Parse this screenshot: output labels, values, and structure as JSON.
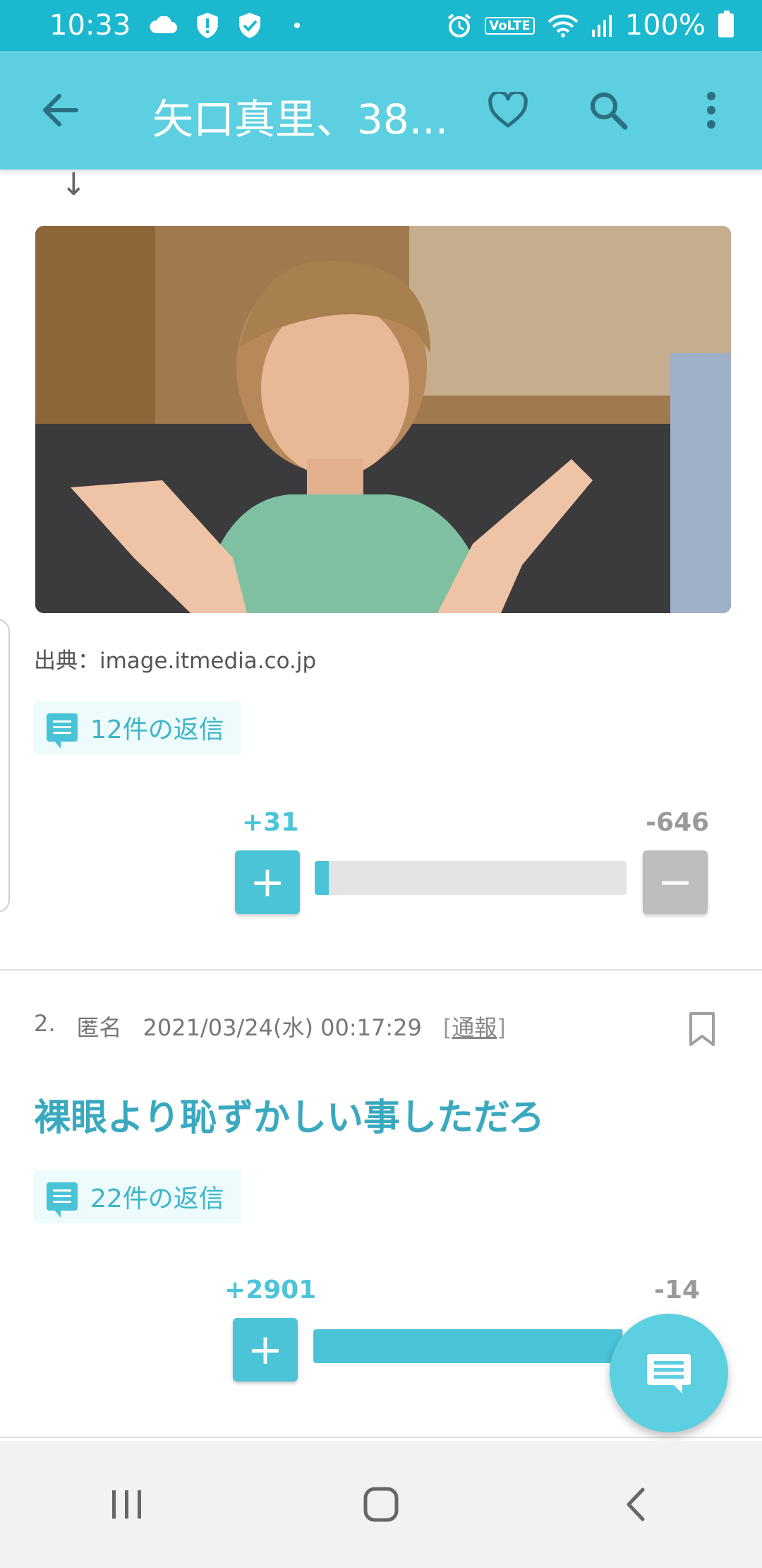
{
  "status_bar": {
    "time": "10:33",
    "battery": "100%",
    "network_badge": "VoLTE",
    "icons": [
      "cloud-icon",
      "shield-alert-icon",
      "shield-check-icon",
      "alarm-icon",
      "wifi-icon",
      "signal-icon",
      "battery-icon"
    ]
  },
  "app_bar": {
    "title": "矢口真里、38...",
    "icons": [
      "back-arrow-icon",
      "heart-icon",
      "search-icon",
      "more-vert-icon"
    ]
  },
  "post1": {
    "down_arrow": "↓",
    "image_alt": "photo",
    "source_label": "出典：image.itmedia.co.jp",
    "replies_label": "12件の返信",
    "plus_count": "+31",
    "minus_count": "-646",
    "plus_button": "+",
    "minus_button": "−",
    "vote_ratio": 0.046
  },
  "post2": {
    "number": "2.",
    "author": "匿名",
    "datetime": "2021/03/24(水) 00:17:29",
    "report_open": "[",
    "report_label": "通報",
    "report_close": "]",
    "text": "裸眼より恥ずかしい事しただろ",
    "replies_label": "22件の返信",
    "plus_count": "+2901",
    "minus_count": "-14",
    "plus_button": "+",
    "vote_ratio": 0.995
  },
  "colors": {
    "status_bar": "#1bb8cf",
    "app_bar": "#5ccfe0",
    "accent": "#4bc4d8",
    "comment_text": "#3aa9bf"
  }
}
